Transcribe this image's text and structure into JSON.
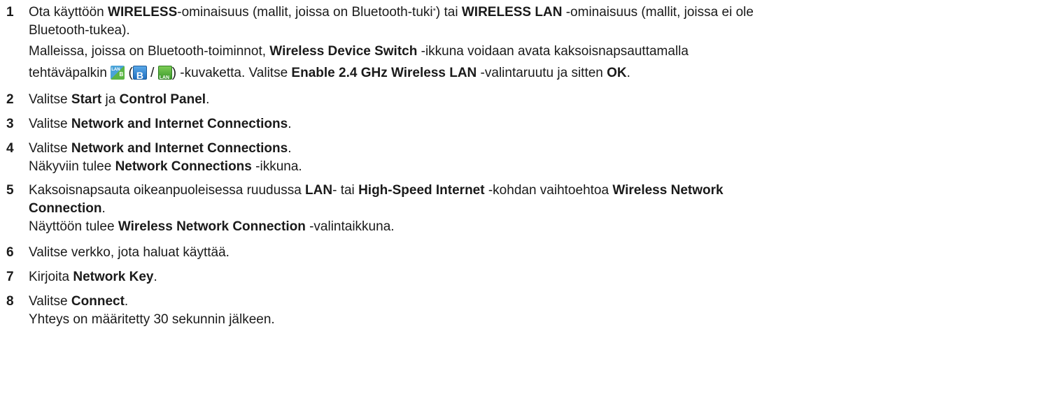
{
  "steps": [
    {
      "number": "1",
      "line1": {
        "t1": "Ota käyttöön ",
        "b1": "WIRELESS",
        "t2": "-ominaisuus (mallit, joissa on Bluetooth-tuki",
        "sup": "*",
        "t3": ") tai ",
        "b2": "WIRELESS LAN",
        "t4": " -ominaisuus (mallit, joissa ei ole"
      },
      "line2": "Bluetooth-tukea).",
      "line3": {
        "t1": "Malleissa, joissa on Bluetooth-toiminnot, ",
        "b1": "Wireless Device Switch",
        "t2": " -ikkuna voidaan avata kaksoisnapsauttamalla"
      },
      "line4": {
        "t1": "tehtäväpalkin ",
        "t2": " (",
        "t3": " / ",
        "t4": ") -kuvaketta. Valitse ",
        "b1": "Enable 2.4 GHz Wireless LAN",
        "t5": " -valintaruutu ja sitten ",
        "b2": "OK",
        "t6": "."
      },
      "icons": [
        "wireless-lan-bluetooth-icon",
        "bluetooth-icon",
        "lan-icon"
      ]
    },
    {
      "number": "2",
      "t1": "Valitse ",
      "b1": "Start",
      "t2": " ja ",
      "b2": "Control Panel",
      "t3": "."
    },
    {
      "number": "3",
      "t1": "Valitse ",
      "b1": "Network and Internet Connections",
      "t2": "."
    },
    {
      "number": "4",
      "line1": {
        "t1": "Valitse ",
        "b1": "Network and Internet Connections",
        "t2": "."
      },
      "line2": {
        "t1": "Näkyviin tulee ",
        "b1": "Network Connections",
        "t2": " -ikkuna."
      }
    },
    {
      "number": "5",
      "line1": {
        "t1": "Kaksoisnapsauta oikeanpuoleisessa ruudussa ",
        "b1": "LAN",
        "t2": "- tai ",
        "b2": "High-Speed Internet",
        "t3": " -kohdan vaihtoehtoa ",
        "b3": "Wireless Network"
      },
      "line2": {
        "b1": "Connection",
        "t1": "."
      },
      "line3": {
        "t1": "Näyttöön tulee ",
        "b1": "Wireless Network Connection",
        "t2": " -valintaikkuna."
      }
    },
    {
      "number": "6",
      "text": "Valitse verkko, jota haluat käyttää."
    },
    {
      "number": "7",
      "t1": "Kirjoita ",
      "b1": "Network Key",
      "t2": "."
    },
    {
      "number": "8",
      "line1": {
        "t1": "Valitse ",
        "b1": "Connect",
        "t2": "."
      },
      "line2": "Yhteys on määritetty 30 sekunnin jälkeen."
    }
  ]
}
